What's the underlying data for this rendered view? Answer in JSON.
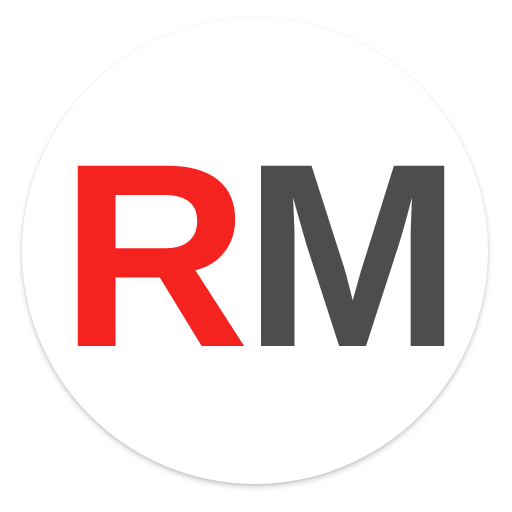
{
  "logo": {
    "letter_1": "R",
    "letter_2": "M",
    "colors": {
      "letter_1": "#f5231f",
      "letter_2": "#4d4d4d",
      "badge_background": "#ffffff"
    }
  }
}
